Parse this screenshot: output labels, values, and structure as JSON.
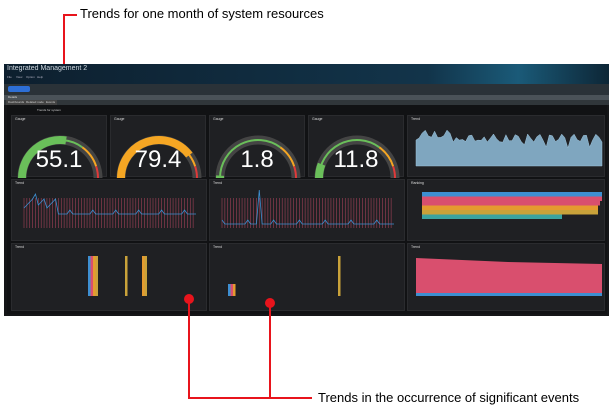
{
  "annotations": {
    "top": "Trends for one month of system resources",
    "bottom": "Trends in the occurrence of significant events"
  },
  "app": {
    "title": "Integrated Management 2",
    "menu": [
      "File",
      "View",
      "Option",
      "Help"
    ],
    "details_label": "Details",
    "tabs": [
      "Dashboards",
      "Related nodes",
      "Events"
    ],
    "breadcrumb": "Trends for system"
  },
  "panels": {
    "gauges": [
      {
        "title": "Gauge",
        "value": "55.1",
        "percent": 55.1,
        "color": "#6abf5a"
      },
      {
        "title": "Gauge",
        "value": "79.4",
        "percent": 79.4,
        "color": "#f5a623"
      },
      {
        "title": "Gauge",
        "value": "1.8",
        "percent": 1.8,
        "color": "#6abf5a"
      },
      {
        "title": "Gauge",
        "value": "11.8",
        "percent": 11.8,
        "color": "#6abf5a"
      }
    ],
    "trend_titles": [
      "Trend",
      "Trend",
      "Trend",
      "Trend",
      "Trend",
      "Trend"
    ],
    "ranking_title": "Ranking"
  },
  "colors": {
    "accent": "#e8141c",
    "series_blue": "#3d8fd1",
    "series_red": "#d94f6e",
    "series_orange": "#e59a2f",
    "series_yellow": "#c9a23a",
    "area": "#7fa6bf"
  }
}
